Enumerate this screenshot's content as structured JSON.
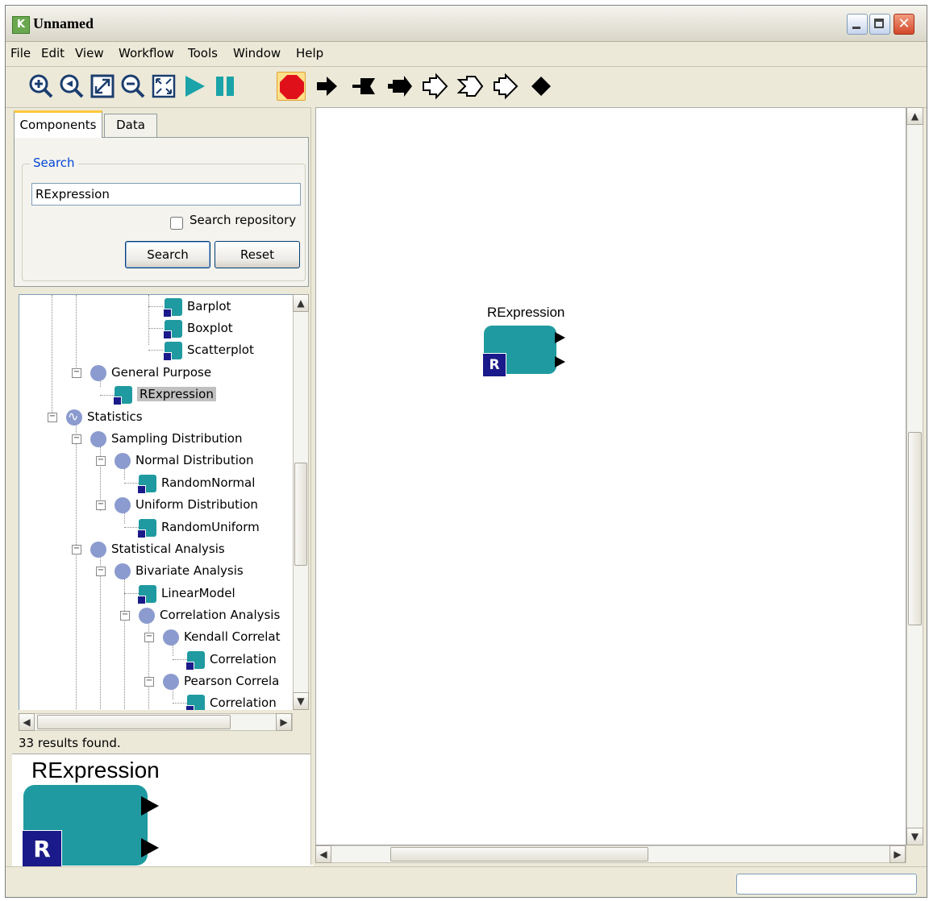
{
  "window": {
    "title": "Unnamed",
    "logo_letter": "K",
    "close_glyph": "✕"
  },
  "menu": [
    "File",
    "Edit",
    "View",
    "Workflow",
    "Tools",
    "Window",
    "Help"
  ],
  "toolbar": {
    "icons": [
      "zoom-in-icon",
      "zoom-reset-icon",
      "zoom-to-fit-icon",
      "zoom-out-icon",
      "fit-window-icon",
      "run-icon",
      "pause-icon",
      "stop-icon",
      "port-arrow-icon",
      "port-flag-icon",
      "port-double-icon",
      "port-outline-arrow-icon",
      "port-outline-flag-icon",
      "port-outline-double-icon",
      "relation-diamond-icon"
    ]
  },
  "left_panel": {
    "tabs": [
      "Components",
      "Data"
    ],
    "active_tab": "Components",
    "search_group_label": "Search",
    "search_value": "RExpression",
    "search_repository_label": "Search repository",
    "search_repository_checked": false,
    "search_button": "Search",
    "reset_button": "Reset",
    "results_text": "33 results found."
  },
  "tree": [
    {
      "label": "Barplot",
      "type": "component"
    },
    {
      "label": "Boxplot",
      "type": "component"
    },
    {
      "label": "Scatterplot",
      "type": "component"
    },
    {
      "label": "General Purpose",
      "type": "folder",
      "expanded": true
    },
    {
      "label": "RExpression",
      "type": "component",
      "selected": true
    },
    {
      "label": "Statistics",
      "type": "root-folder",
      "expanded": true
    },
    {
      "label": "Sampling Distribution",
      "type": "folder",
      "expanded": true
    },
    {
      "label": "Normal Distribution",
      "type": "folder",
      "expanded": true
    },
    {
      "label": "RandomNormal",
      "type": "component"
    },
    {
      "label": "Uniform Distribution",
      "type": "folder",
      "expanded": true
    },
    {
      "label": "RandomUniform",
      "type": "component"
    },
    {
      "label": "Statistical Analysis",
      "type": "folder",
      "expanded": true
    },
    {
      "label": "Bivariate Analysis",
      "type": "folder",
      "expanded": true
    },
    {
      "label": "LinearModel",
      "type": "component"
    },
    {
      "label": "Correlation Analysis",
      "type": "folder",
      "expanded": true
    },
    {
      "label": "Kendall Correlat",
      "type": "folder",
      "expanded": true
    },
    {
      "label": "Correlation",
      "type": "component"
    },
    {
      "label": "Pearson Correla",
      "type": "folder",
      "expanded": true
    },
    {
      "label": "Correlation",
      "type": "component"
    }
  ],
  "preview": {
    "title": "RExpression",
    "badge": "R"
  },
  "canvas": {
    "actor_title": "RExpression",
    "actor_badge": "R"
  },
  "colors": {
    "actor_teal": "#1f9aa0",
    "badge_navy": "#1a1a8a",
    "run_green": "#1aa3a8",
    "stop_red": "#e0101a",
    "stop_highlight": "#ffe08a"
  }
}
